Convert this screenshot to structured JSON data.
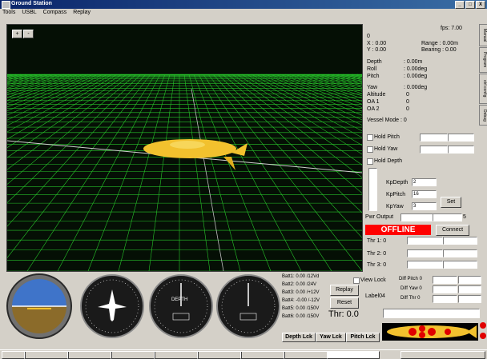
{
  "window": {
    "title": "Ground Station",
    "minimize": "_",
    "maximize": "□",
    "close": "X"
  },
  "menu": [
    "Tools",
    "USBL",
    "Compass",
    "Replay"
  ],
  "view3d": {
    "zoom_in": "+",
    "zoom_out": "-"
  },
  "telemetry": {
    "fps": "fps: 7.00",
    "zero": "0",
    "x": "X        : 0.00",
    "y": "Y        : 0.00",
    "range": "Range : 0.00m",
    "bearing": "Bearing : 0.00",
    "depth_label": "Depth",
    "depth_value": ": 0.00m",
    "roll_label": "Roll",
    "roll_value": ": 0.00deg",
    "pitch_label": "Pitch",
    "pitch_value": ": 0.00deg",
    "yaw_label": "Yaw",
    "yaw_value": ": 0.00deg",
    "altitude_label": "Altitude",
    "altitude_value": "0",
    "oa1_label": "OA 1",
    "oa1_value": "0",
    "oa2_label": "OA 2",
    "oa2_value": "0",
    "vessel_mode": "Vessel Mode : 0"
  },
  "tabs": [
    "Manual",
    "Program",
    "ctrl config",
    "Debug"
  ],
  "controls": {
    "hold_pitch": "Hold Pitch",
    "hold_yaw": "Hold Yaw",
    "hold_depth": "Hold Depth",
    "kp_depth_label": "KpDepth",
    "kp_depth_value": "2",
    "kp_pitch_label": "KpPitch",
    "kp_pitch_value": "16",
    "kp_yaw_label": "KpYaw",
    "kp_yaw_value": "3",
    "set_button": "Set",
    "pwr_output_label": "Pwr Output",
    "pwr_output_unit": "5",
    "offline": "OFFLINE",
    "connect_button": "Connect",
    "thr1": "Thr 1: 0",
    "thr2": "Thr 2: 0",
    "thr3": "Thr 3: 0"
  },
  "gauges": {
    "depth_label": "DEPTH"
  },
  "batteries": [
    "Batt1: 0.00 /12Vd",
    "Batt2: 0.00 /24V",
    "Batt3: 0.00 /+12V",
    "Batt4: -0.00 /-12V",
    "Batt5: 0.00 /150V",
    "Batt6: 0.00 /150V"
  ],
  "bottom": {
    "replay_button": "Replay",
    "reset_button": "Reset",
    "view_lock": "View Lock",
    "label04": "Label04",
    "thr_total": "Thr: 0.0",
    "diff_pitch": "Diff Pitch 0",
    "diff_yaw": "Diff Yaw 0",
    "diff_thr": "Diff Thr 0",
    "depth_lock": "Depth Lck",
    "yaw_lock": "Yaw Lck",
    "pitch_lock": "Pitch Lck"
  },
  "colors": {
    "grid": "#27c42a",
    "offline": "#ff0000",
    "submarine": "#f2c12e",
    "thruster": "#e00000"
  }
}
